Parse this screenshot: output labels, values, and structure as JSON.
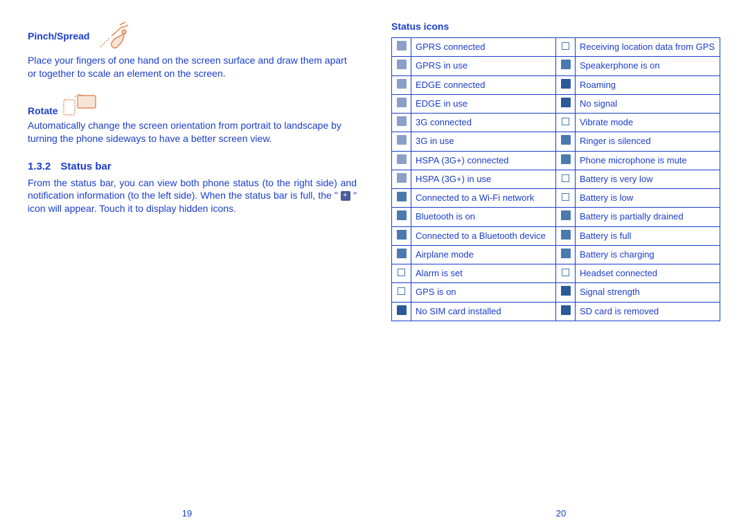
{
  "left": {
    "pinch_title": "Pinch/Spread",
    "pinch_body": "Place your fingers of one hand on the screen surface and draw them apart or together to scale an element on the screen.",
    "rotate_title": "Rotate",
    "rotate_body": "Automatically change the screen orientation from portrait to landscape by turning the phone sideways to have a better screen view.",
    "section_num": "1.3.2",
    "section_title": "Status bar",
    "statusbar_body_a": "From the status bar, you can view both phone status (to the right side) and notification information (to the left side). When the status bar is full, the \" ",
    "statusbar_body_b": " \" icon will appear. Touch it to display hidden icons.",
    "page_num": "19"
  },
  "right": {
    "title": "Status icons",
    "rows": [
      {
        "l": "GPRS connected",
        "li": "gprs-connected-icon",
        "r": "Receiving location data from GPS",
        "ri": "gps-receiving-icon"
      },
      {
        "l": "GPRS in use",
        "li": "gprs-inuse-icon",
        "r": "Speakerphone is on",
        "ri": "speakerphone-icon"
      },
      {
        "l": "EDGE connected",
        "li": "edge-connected-icon",
        "r": "Roaming",
        "ri": "roaming-icon"
      },
      {
        "l": "EDGE in use",
        "li": "edge-inuse-icon",
        "r": "No signal",
        "ri": "no-signal-icon"
      },
      {
        "l": "3G connected",
        "li": "3g-connected-icon",
        "r": "Vibrate mode",
        "ri": "vibrate-icon"
      },
      {
        "l": "3G in use",
        "li": "3g-inuse-icon",
        "r": "Ringer is silenced",
        "ri": "ringer-silenced-icon"
      },
      {
        "l": "HSPA (3G+) connected",
        "li": "hspa-connected-icon",
        "r": "Phone microphone is mute",
        "ri": "mic-mute-icon"
      },
      {
        "l": "HSPA (3G+) in use",
        "li": "hspa-inuse-icon",
        "r": "Battery is very low",
        "ri": "battery-verylow-icon"
      },
      {
        "l": "Connected to a Wi-Fi network",
        "li": "wifi-icon",
        "r": "Battery is low",
        "ri": "battery-low-icon"
      },
      {
        "l": "Bluetooth is on",
        "li": "bluetooth-icon",
        "r": "Battery is partially drained",
        "ri": "battery-partial-icon"
      },
      {
        "l": "Connected to a Bluetooth device",
        "li": "bluetooth-connected-icon",
        "r": "Battery is full",
        "ri": "battery-full-icon"
      },
      {
        "l": "Airplane mode",
        "li": "airplane-icon",
        "r": "Battery is charging",
        "ri": "battery-charging-icon"
      },
      {
        "l": "Alarm is set",
        "li": "alarm-icon",
        "r": "Headset connected",
        "ri": "headset-icon"
      },
      {
        "l": "GPS is on",
        "li": "gps-on-icon",
        "r": "Signal strength",
        "ri": "signal-icon"
      },
      {
        "l": "No SIM card installed",
        "li": "no-sim-icon",
        "r": "SD card is removed",
        "ri": "sd-removed-icon"
      }
    ],
    "icon_style": {
      "gprs-connected-icon": "mi-net",
      "gprs-inuse-icon": "mi-net",
      "edge-connected-icon": "mi-net",
      "edge-inuse-icon": "mi-net",
      "3g-connected-icon": "mi-net",
      "3g-inuse-icon": "mi-net",
      "hspa-connected-icon": "mi-net",
      "hspa-inuse-icon": "mi-net",
      "wifi-icon": "mi-blue",
      "bluetooth-icon": "mi-blue",
      "bluetooth-connected-icon": "mi-blue",
      "airplane-icon": "mi-blue",
      "alarm-icon": "mi-outline",
      "gps-on-icon": "mi-outline",
      "no-sim-icon": "mi-dark",
      "gps-receiving-icon": "mi-outline",
      "speakerphone-icon": "mi-blue",
      "roaming-icon": "mi-dark",
      "no-signal-icon": "mi-dark",
      "vibrate-icon": "mi-outline",
      "ringer-silenced-icon": "mi-blue",
      "mic-mute-icon": "mi-blue",
      "battery-verylow-icon": "mi-outline",
      "battery-low-icon": "mi-outline",
      "battery-partial-icon": "mi-blue",
      "battery-full-icon": "mi-blue",
      "battery-charging-icon": "mi-blue",
      "headset-icon": "mi-outline",
      "signal-icon": "mi-dark",
      "sd-removed-icon": "mi-dark"
    },
    "page_num": "20"
  }
}
